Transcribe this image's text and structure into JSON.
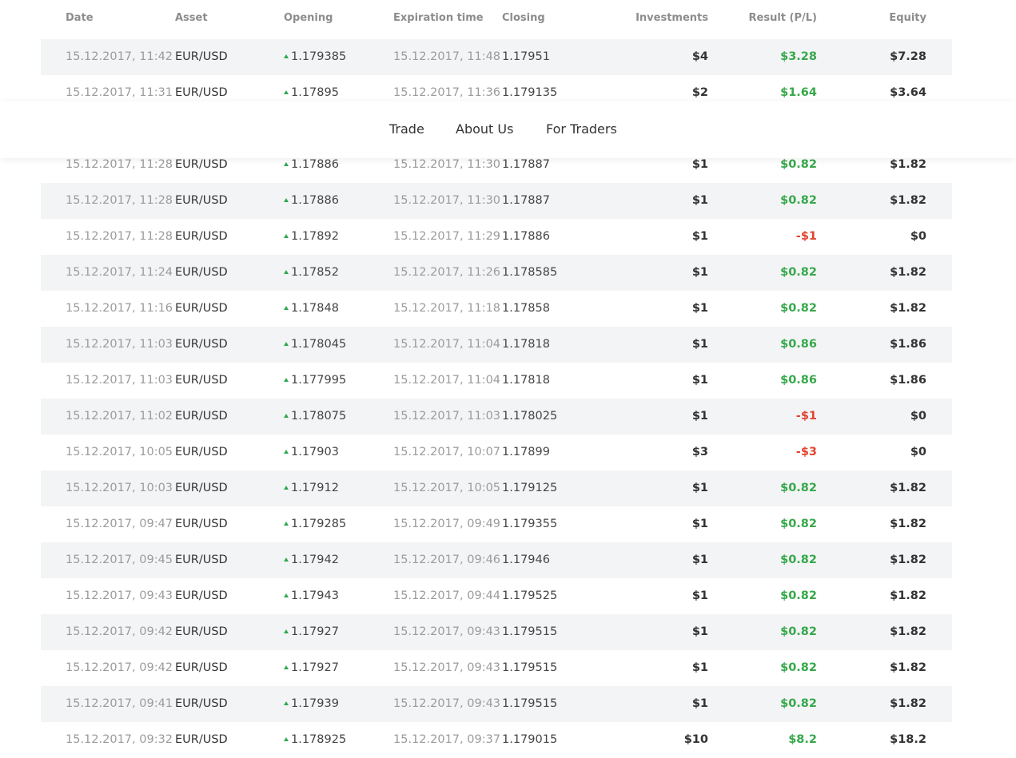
{
  "header": {
    "date": "Date",
    "asset": "Asset",
    "opening": "Opening",
    "expiration": "Expiration time",
    "closing": "Closing",
    "investments": "Investments",
    "result": "Result (P/L)",
    "equity": "Equity"
  },
  "nav": {
    "trade": "Trade",
    "about": "About Us",
    "traders": "For Traders"
  },
  "colors": {
    "positive": "#37a84b",
    "negative": "#e0452e",
    "up_arrow": "#2fa84f",
    "row_shade": "#f3f4f6"
  },
  "rows": [
    {
      "date": "15.12.2017, 11:42",
      "asset": "EUR/USD",
      "opening": "1.179385",
      "expiration": "15.12.2017, 11:48",
      "closing": "1.17951",
      "investment": "$4",
      "result": "$3.28",
      "result_sign": "pos",
      "equity": "$7.28"
    },
    {
      "date": "15.12.2017, 11:31",
      "asset": "EUR/USD",
      "opening": "1.17895",
      "expiration": "15.12.2017, 11:36",
      "closing": "1.179135",
      "investment": "$2",
      "result": "$1.64",
      "result_sign": "pos",
      "equity": "$3.64"
    },
    {
      "date": "",
      "asset": "",
      "opening": "",
      "expiration": "",
      "closing": "",
      "investment": "",
      "result": "",
      "result_sign": "pos",
      "equity": ""
    },
    {
      "date": "15.12.2017, 11:28",
      "asset": "EUR/USD",
      "opening": "1.17886",
      "expiration": "15.12.2017, 11:30",
      "closing": "1.17887",
      "investment": "$1",
      "result": "$0.82",
      "result_sign": "pos",
      "equity": "$1.82"
    },
    {
      "date": "15.12.2017, 11:28",
      "asset": "EUR/USD",
      "opening": "1.17886",
      "expiration": "15.12.2017, 11:30",
      "closing": "1.17887",
      "investment": "$1",
      "result": "$0.82",
      "result_sign": "pos",
      "equity": "$1.82"
    },
    {
      "date": "15.12.2017, 11:28",
      "asset": "EUR/USD",
      "opening": "1.17892",
      "expiration": "15.12.2017, 11:29",
      "closing": "1.17886",
      "investment": "$1",
      "result": "-$1",
      "result_sign": "neg",
      "equity": "$0"
    },
    {
      "date": "15.12.2017, 11:24",
      "asset": "EUR/USD",
      "opening": "1.17852",
      "expiration": "15.12.2017, 11:26",
      "closing": "1.178585",
      "investment": "$1",
      "result": "$0.82",
      "result_sign": "pos",
      "equity": "$1.82"
    },
    {
      "date": "15.12.2017, 11:16",
      "asset": "EUR/USD",
      "opening": "1.17848",
      "expiration": "15.12.2017, 11:18",
      "closing": "1.17858",
      "investment": "$1",
      "result": "$0.82",
      "result_sign": "pos",
      "equity": "$1.82"
    },
    {
      "date": "15.12.2017, 11:03",
      "asset": "EUR/USD",
      "opening": "1.178045",
      "expiration": "15.12.2017, 11:04",
      "closing": "1.17818",
      "investment": "$1",
      "result": "$0.86",
      "result_sign": "pos",
      "equity": "$1.86"
    },
    {
      "date": "15.12.2017, 11:03",
      "asset": "EUR/USD",
      "opening": "1.177995",
      "expiration": "15.12.2017, 11:04",
      "closing": "1.17818",
      "investment": "$1",
      "result": "$0.86",
      "result_sign": "pos",
      "equity": "$1.86"
    },
    {
      "date": "15.12.2017, 11:02",
      "asset": "EUR/USD",
      "opening": "1.178075",
      "expiration": "15.12.2017, 11:03",
      "closing": "1.178025",
      "investment": "$1",
      "result": "-$1",
      "result_sign": "neg",
      "equity": "$0"
    },
    {
      "date": "15.12.2017, 10:05",
      "asset": "EUR/USD",
      "opening": "1.17903",
      "expiration": "15.12.2017, 10:07",
      "closing": "1.17899",
      "investment": "$3",
      "result": "-$3",
      "result_sign": "neg",
      "equity": "$0"
    },
    {
      "date": "15.12.2017, 10:03",
      "asset": "EUR/USD",
      "opening": "1.17912",
      "expiration": "15.12.2017, 10:05",
      "closing": "1.179125",
      "investment": "$1",
      "result": "$0.82",
      "result_sign": "pos",
      "equity": "$1.82"
    },
    {
      "date": "15.12.2017, 09:47",
      "asset": "EUR/USD",
      "opening": "1.179285",
      "expiration": "15.12.2017, 09:49",
      "closing": "1.179355",
      "investment": "$1",
      "result": "$0.82",
      "result_sign": "pos",
      "equity": "$1.82"
    },
    {
      "date": "15.12.2017, 09:45",
      "asset": "EUR/USD",
      "opening": "1.17942",
      "expiration": "15.12.2017, 09:46",
      "closing": "1.17946",
      "investment": "$1",
      "result": "$0.82",
      "result_sign": "pos",
      "equity": "$1.82"
    },
    {
      "date": "15.12.2017, 09:43",
      "asset": "EUR/USD",
      "opening": "1.17943",
      "expiration": "15.12.2017, 09:44",
      "closing": "1.179525",
      "investment": "$1",
      "result": "$0.82",
      "result_sign": "pos",
      "equity": "$1.82"
    },
    {
      "date": "15.12.2017, 09:42",
      "asset": "EUR/USD",
      "opening": "1.17927",
      "expiration": "15.12.2017, 09:43",
      "closing": "1.179515",
      "investment": "$1",
      "result": "$0.82",
      "result_sign": "pos",
      "equity": "$1.82"
    },
    {
      "date": "15.12.2017, 09:42",
      "asset": "EUR/USD",
      "opening": "1.17927",
      "expiration": "15.12.2017, 09:43",
      "closing": "1.179515",
      "investment": "$1",
      "result": "$0.82",
      "result_sign": "pos",
      "equity": "$1.82"
    },
    {
      "date": "15.12.2017, 09:41",
      "asset": "EUR/USD",
      "opening": "1.17939",
      "expiration": "15.12.2017, 09:43",
      "closing": "1.179515",
      "investment": "$1",
      "result": "$0.82",
      "result_sign": "pos",
      "equity": "$1.82"
    },
    {
      "date": "15.12.2017, 09:32",
      "asset": "EUR/USD",
      "opening": "1.178925",
      "expiration": "15.12.2017, 09:37",
      "closing": "1.179015",
      "investment": "$10",
      "result": "$8.2",
      "result_sign": "pos",
      "equity": "$18.2"
    }
  ]
}
